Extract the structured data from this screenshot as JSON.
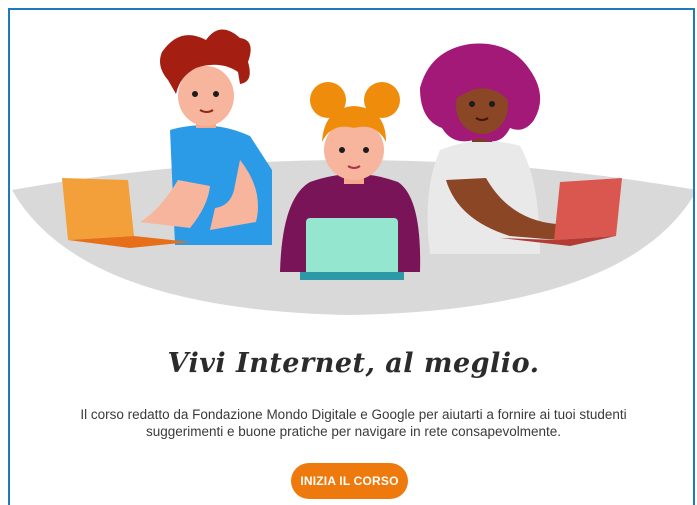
{
  "hero": {
    "title": "Vivi Internet, al meglio.",
    "description": "Il corso redatto da Fondazione Mondo Digitale e Google per aiutarti a fornire ai tuoi studenti suggerimenti e buone pratiche per navigare in rete consapevolmente.",
    "cta_label": "INIZIA IL CORSO"
  },
  "colors": {
    "frame_border": "#1f7ab8",
    "cta_background": "#ee7a0d",
    "title_text": "#2b2b2b",
    "illustration_base": "#d9d9d9"
  },
  "illustration": {
    "people": [
      "boy-orange-laptop",
      "girl-teal-laptop",
      "woman-red-laptop"
    ]
  }
}
